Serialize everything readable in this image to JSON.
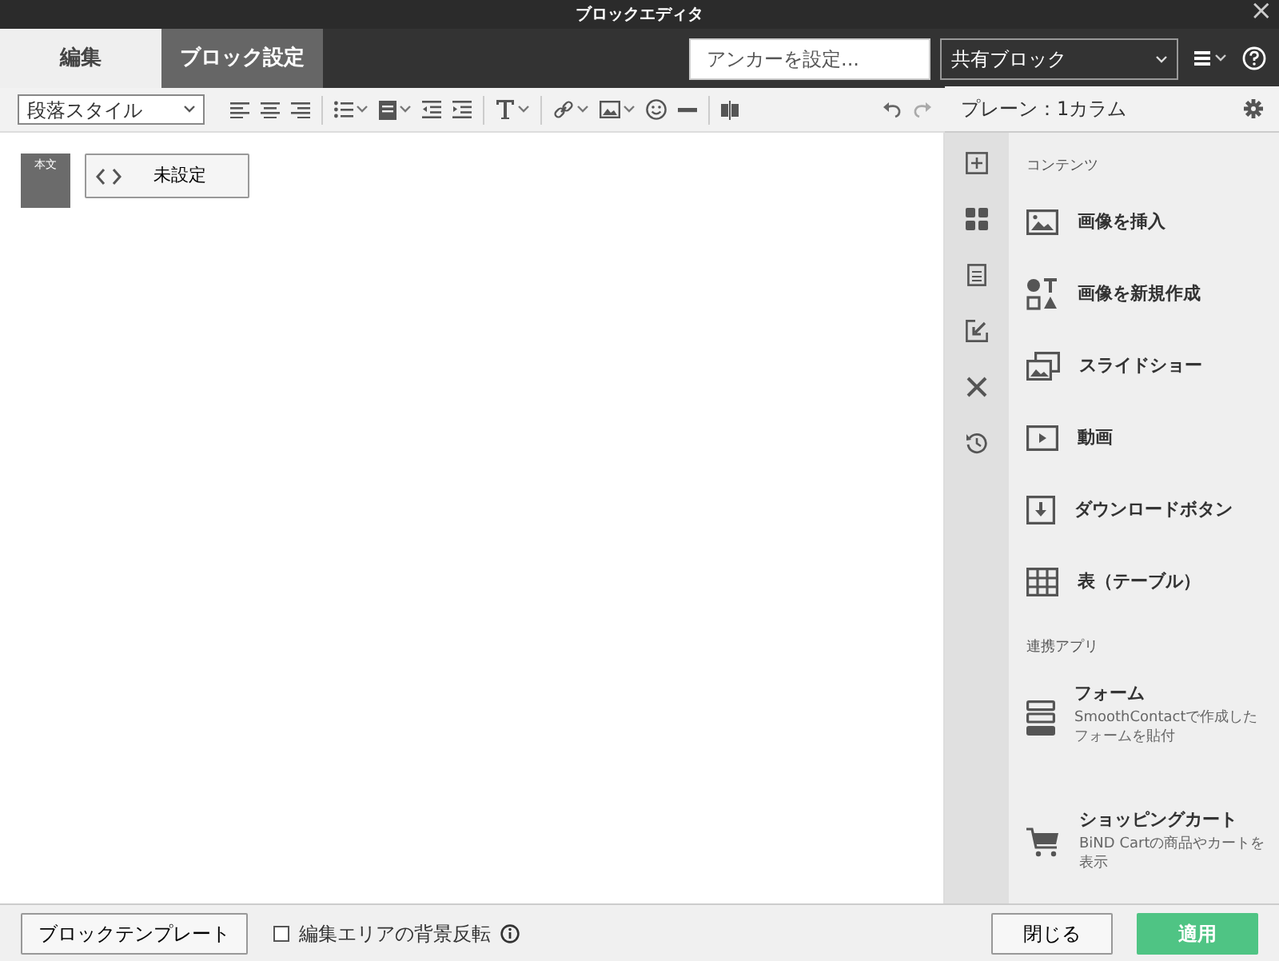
{
  "window": {
    "title": "ブロックエディタ",
    "close": "×"
  },
  "tabs": [
    {
      "label": "編集",
      "selected": true
    },
    {
      "label": "ブロック設定",
      "selected": false
    }
  ],
  "anchor": {
    "placeholder": "アンカーを設定..."
  },
  "shared_block": {
    "value": "共有ブロック"
  },
  "toolbar": {
    "paragraph_style": "段落スタイル"
  },
  "panel": {
    "title": "プレーン：1カラム"
  },
  "block": {
    "tag": "本文",
    "button": "未設定"
  },
  "sections": [
    {
      "heading": "コンテンツ",
      "items": [
        {
          "kind": "image",
          "label": "画像を挿入"
        },
        {
          "kind": "shapes",
          "label": "画像を新規作成"
        },
        {
          "kind": "slideshow",
          "label": "スライドショー"
        },
        {
          "kind": "video",
          "label": "動画"
        },
        {
          "kind": "download",
          "label": "ダウンロードボタン"
        },
        {
          "kind": "table",
          "label": "表（テーブル）"
        }
      ]
    },
    {
      "heading": "連携アプリ",
      "items": [
        {
          "kind": "form",
          "label": "フォーム",
          "description": "SmoothContactで作成したフォームを貼付"
        },
        {
          "kind": "cart",
          "label": "ショッピングカート",
          "description": "BiND Cartの商品やカートを表示"
        }
      ]
    }
  ],
  "footer": {
    "template_button": "ブロックテンプレート",
    "invert_label": "編集エリアの背景反転",
    "invert_checked": false,
    "close_button": "閉じる",
    "apply_button": "適用"
  }
}
